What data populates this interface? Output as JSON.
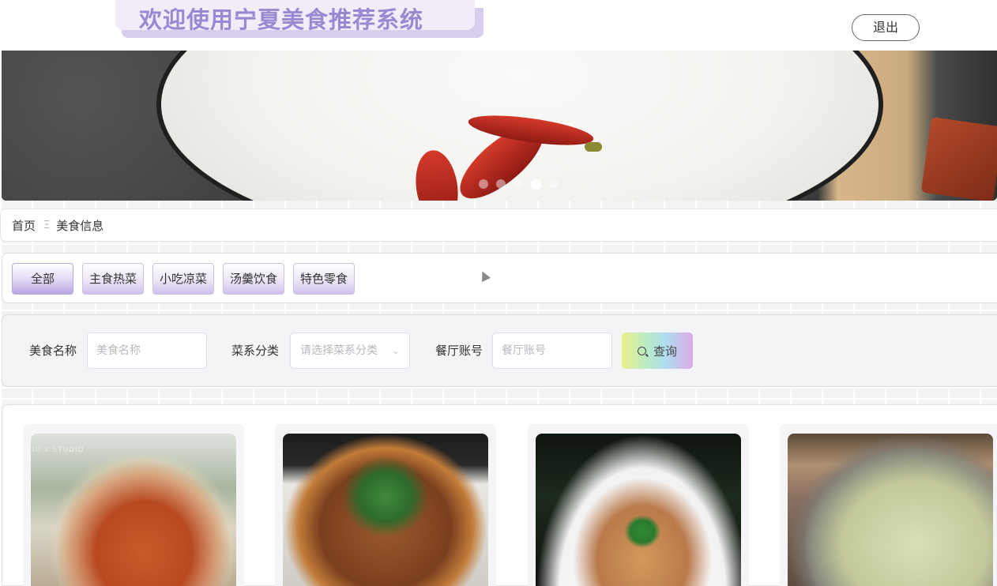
{
  "header": {
    "title": "欢迎使用宁夏美食推荐系统",
    "logout_label": "退出"
  },
  "banner": {
    "slide_count": 5,
    "active_slide_index": 3
  },
  "breadcrumb": {
    "items": [
      "首页",
      "美食信息"
    ],
    "separator": "Ξ"
  },
  "categories": {
    "items": [
      {
        "label": "全部",
        "active": true
      },
      {
        "label": "主食热菜",
        "active": false
      },
      {
        "label": "小吃凉菜",
        "active": false
      },
      {
        "label": "汤羹饮食",
        "active": false
      },
      {
        "label": "特色零食",
        "active": false
      }
    ]
  },
  "search": {
    "name_label": "美食名称",
    "name_placeholder": "美食名称",
    "name_value": "",
    "category_label": "菜系分类",
    "category_placeholder": "请选择菜系分类",
    "restaurant_label": "餐厅账号",
    "restaurant_placeholder": "餐厅账号",
    "restaurant_value": "",
    "submit_label": "查询"
  },
  "food_list": {
    "items": [
      {
        "image": "beef-noodle-soup",
        "watermark": "IU x STUDIO"
      },
      {
        "image": "stir-fried-lamb-with-cilantro",
        "watermark": ""
      },
      {
        "image": "noodles-with-scallion-topping",
        "watermark": ""
      },
      {
        "image": "mutton-dumpling-soup",
        "watermark": ""
      }
    ]
  },
  "colors": {
    "title_text": "#9b88d2",
    "title_bg": "#f1ecf8",
    "category_accent": "#b9a6e4"
  }
}
